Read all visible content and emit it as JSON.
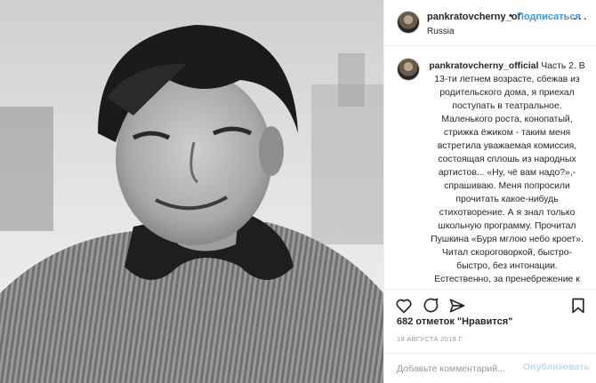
{
  "post": {
    "username": "pankratovcherny_of",
    "separator": "•",
    "follow_label": "Подписаться",
    "location": "Russia",
    "more_label": "···"
  },
  "caption": {
    "username": "pankratovcherny_official",
    "text": "Часть 2. В 13-ти летнем возрасте, сбежав из родительского дома, я приехал поступать в театральное. Маленького роста, конопатый, стрижка ёжиком - таким меня встретила уважаемая комиссия, состоящая сплошь из народных артистов... «Ну, чё вам надо?»,- спрашиваю. Меня попросили прочитать какое-нибудь стихотворение. А я знал только школьную программу. Прочитал Пушкина «Буря мглою небо кроет». Читал скороговоркой, быстро-быстро, без интонации. Естественно, за пренебрежение к поэзии меня сразу забраковали. Педагог по сценической речи, Л.А. Булюбаш при"
  },
  "stats": {
    "likes": "682 отметок \"Нравится\"",
    "date": "18 АВГУСТА 2018 Г."
  },
  "comment": {
    "placeholder": "Добавьте комментарий...",
    "publish_label": "Опубликовать"
  },
  "icons": {
    "like": "heart-icon",
    "comment": "comment-icon",
    "share": "share-icon",
    "save": "bookmark-icon"
  },
  "colors": {
    "link_blue": "#3897f0",
    "publish_disabled": "#b2dffc",
    "text": "#262626",
    "muted": "#999999",
    "border": "#efefef"
  }
}
